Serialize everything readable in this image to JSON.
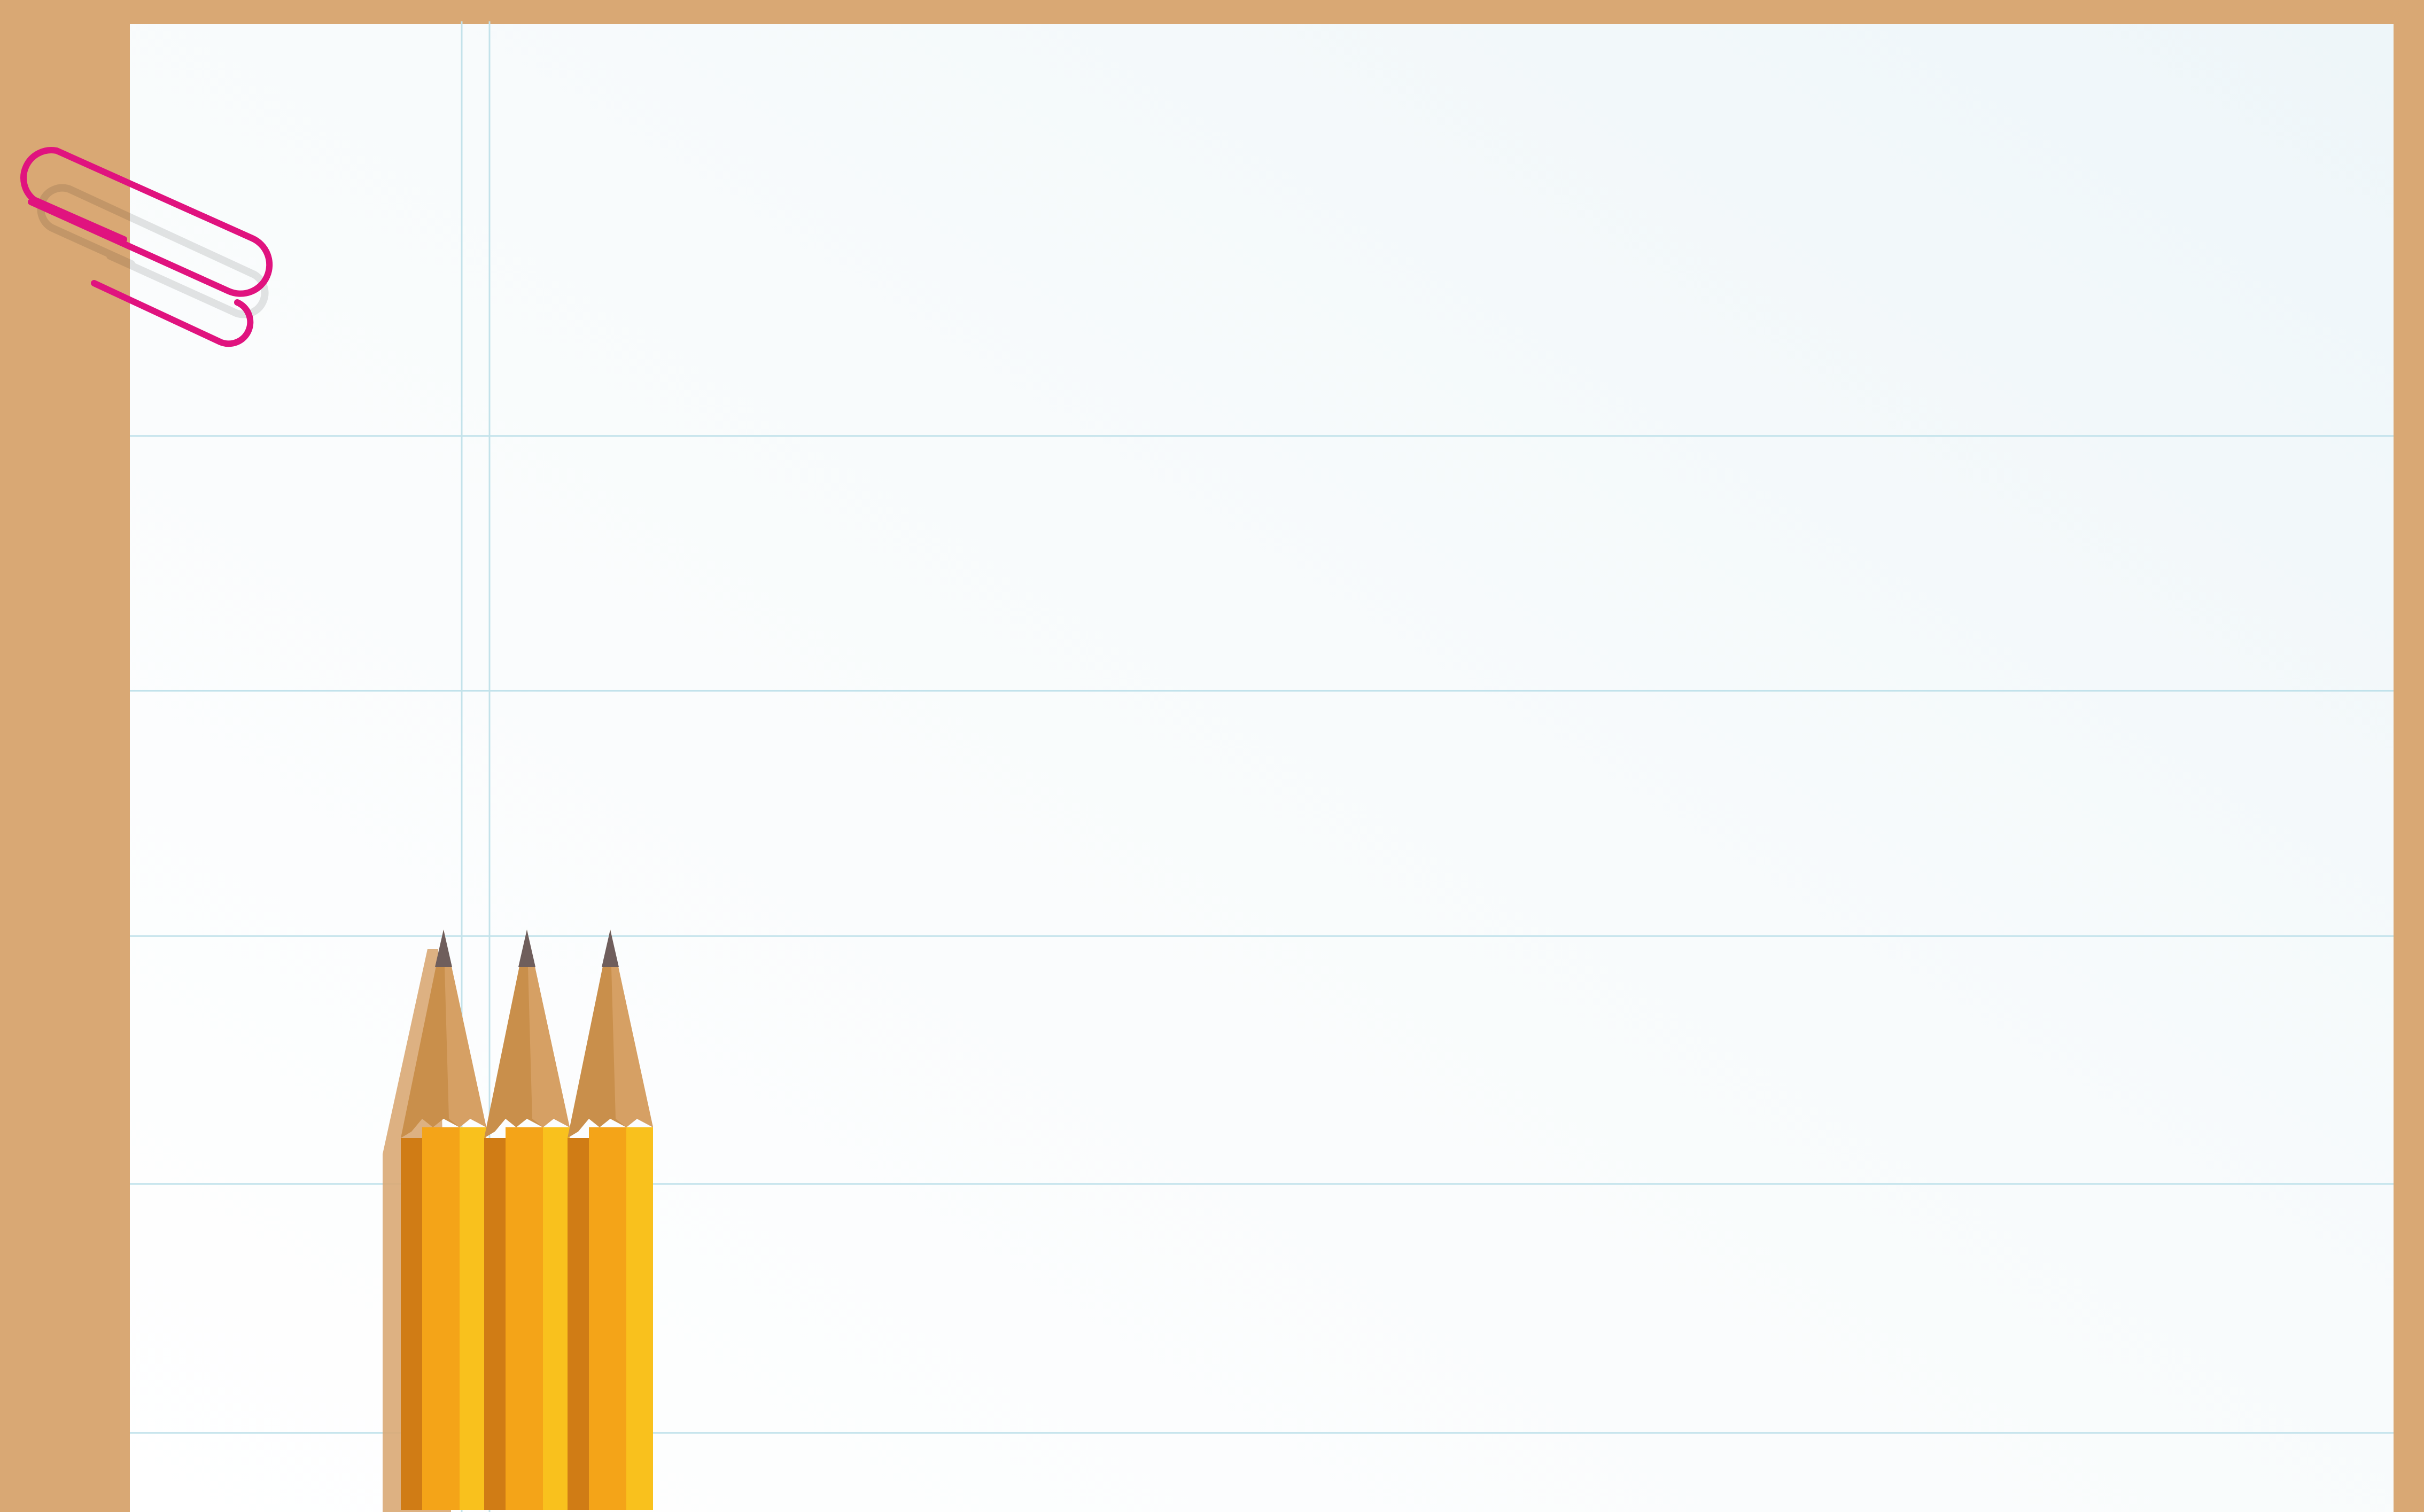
{
  "scene": {
    "description_visible_text": "",
    "colors": {
      "board": "#d9a874",
      "paper": "#fbfdfe",
      "paper_shade": "#eef5f8",
      "rule_line": "#b9dfe9",
      "margin_line": "#b9dfe9",
      "clip": "#e0137f",
      "pencil_yellow": "#f9c11d",
      "pencil_orange": "#f4a418",
      "pencil_dark": "#d07c15",
      "wood": "#c98f4b",
      "wood_light": "#dba66a",
      "graphite": "#6f5e5c"
    },
    "objects": {
      "paper": "lined-paper",
      "clip": "paper-clip-icon",
      "pencils": [
        "pencil",
        "pencil",
        "pencil"
      ]
    }
  }
}
